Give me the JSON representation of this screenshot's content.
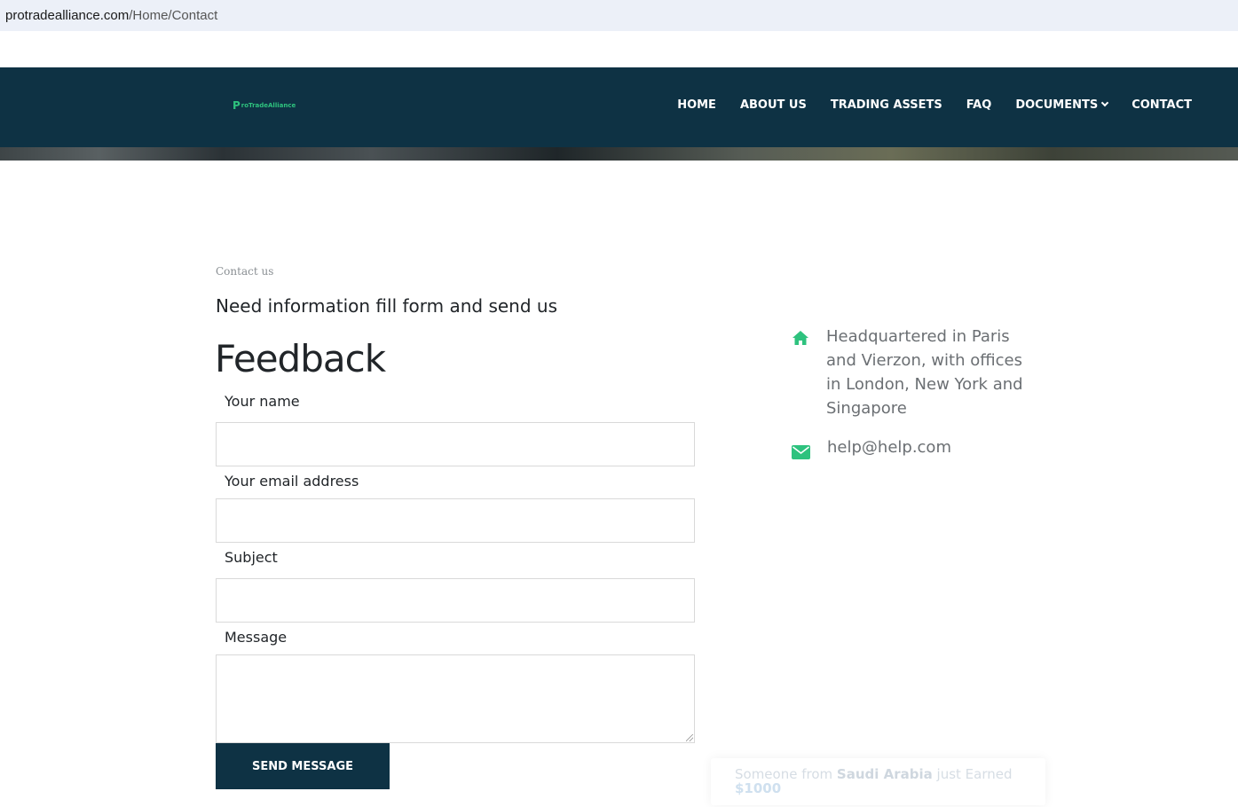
{
  "browser": {
    "url_host": "protradealliance.com",
    "url_path": "/Home/Contact"
  },
  "header": {
    "logo_mark": "P",
    "logo_text": "roTradeAlliance",
    "nav": [
      {
        "label": "HOME"
      },
      {
        "label": "ABOUT US"
      },
      {
        "label": "TRADING ASSETS"
      },
      {
        "label": "FAQ"
      },
      {
        "label": "DOCUMENTS"
      },
      {
        "label": "CONTACT"
      }
    ],
    "dropdown_icon": "chevron-down-icon"
  },
  "contact": {
    "eyebrow": "Contact us",
    "intro": "Need information fill form and send us",
    "title": "Feedback",
    "fields": {
      "name_label": "Your name",
      "name_value": "",
      "email_label": "Your email address",
      "email_value": "",
      "subject_label": "Subject",
      "subject_value": "",
      "message_label": "Message",
      "message_value": ""
    },
    "submit_label": "SEND MESSAGE"
  },
  "info": {
    "address": "Headquartered in Paris and Vierzon, with offices in London, New York and Singapore",
    "address_icon": "home-icon",
    "email": "help@help.com",
    "email_icon": "envelope-icon",
    "accent_color": "#2ec27e"
  },
  "toast": {
    "prefix": "Someone from",
    "country": "Saudi Arabia",
    "suffix": "just Earned",
    "amount": "$1000"
  },
  "colors": {
    "navbar": "#0e3244",
    "button": "#0e3244",
    "accent": "#2ec27e"
  }
}
